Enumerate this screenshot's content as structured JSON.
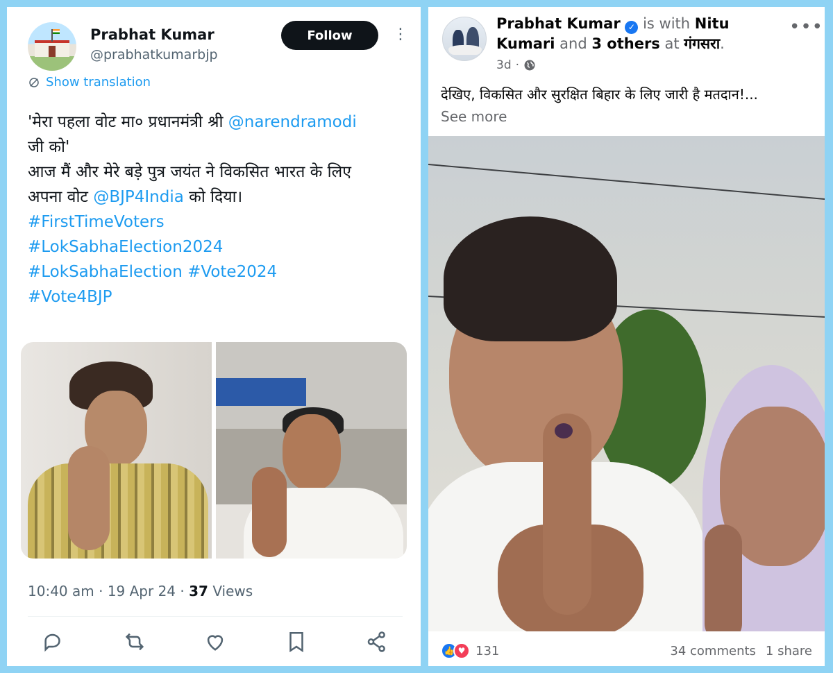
{
  "tweet": {
    "name": "Prabhat Kumar",
    "handle": "@prabhatkumarbjp",
    "follow_label": "Follow",
    "translate_label": "Show translation",
    "body": {
      "line1_a": "'मेरा पहला वोट मा० प्रधानमंत्री श्री ",
      "line1_link": "@narendramodi",
      "line2": "जी को'",
      "line3": "आज मैं और मेरे बड़े पुत्र जयंत ने विकसित भारत के लिए",
      "line4_a": "अपना वोट ",
      "line4_link": "@BJP4India",
      "line4_b": " को दिया।",
      "hashtag1": "#FirstTimeVoters",
      "hashtag2": "#LokSabhaElection2024",
      "hashtag3": "#LokSabhaElection",
      "hashtag4": "#Vote2024",
      "hashtag5": "#Vote4BJP"
    },
    "time": "10:40 am",
    "date": "19 Apr 24",
    "views_count": "37",
    "views_label": "Views",
    "colors": {
      "link": "#1d9bf0",
      "text": "#0f1419",
      "muted": "#536471"
    }
  },
  "facebook": {
    "author": "Prabhat Kumar",
    "with_text": "is with",
    "tagged": "Nitu Kumari",
    "and_text": "and",
    "others": "3 others",
    "at_text": "at",
    "place": "गंगसरा",
    "time": "3d",
    "post_text": "देखिए, विकसित और सुरक्षित बिहार के लिए जारी है मतदान!...",
    "see_more": "See more",
    "reactions_count": "131",
    "comments": "34 comments",
    "shares": "1 share",
    "colors": {
      "brand": "#1877f2",
      "love": "#f33e58",
      "muted": "#65676b"
    }
  },
  "background_color": "#8fd3f4"
}
